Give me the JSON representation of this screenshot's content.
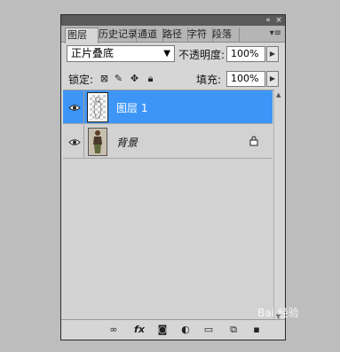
{
  "tabs": [
    {
      "label": "图层",
      "active": true
    },
    {
      "label": "历史记录",
      "active": false
    },
    {
      "label": "通道",
      "active": false
    },
    {
      "label": "路径",
      "active": false
    },
    {
      "label": "字符",
      "active": false
    },
    {
      "label": "段落",
      "active": false
    }
  ],
  "blend_mode": {
    "selected": "正片叠底"
  },
  "opacity": {
    "label": "不透明度:",
    "value": "100%"
  },
  "lock": {
    "label": "锁定:"
  },
  "fill": {
    "label": "填充:",
    "value": "100%"
  },
  "layers": [
    {
      "name": "图层 1",
      "selected": true,
      "visible": true
    },
    {
      "name": "背景",
      "selected": false,
      "visible": true,
      "locked": true
    }
  ],
  "bottom_icons": [
    "link-icon",
    "fx-icon",
    "mask-icon",
    "adjustment-icon",
    "folder-icon",
    "new-layer-icon",
    "trash-icon"
  ],
  "bottom": {
    "fx_label": "fx"
  },
  "watermark": "Bai 经验",
  "colors": {
    "selection": "#3d96f7",
    "panel_bg": "#d6d6d6"
  }
}
